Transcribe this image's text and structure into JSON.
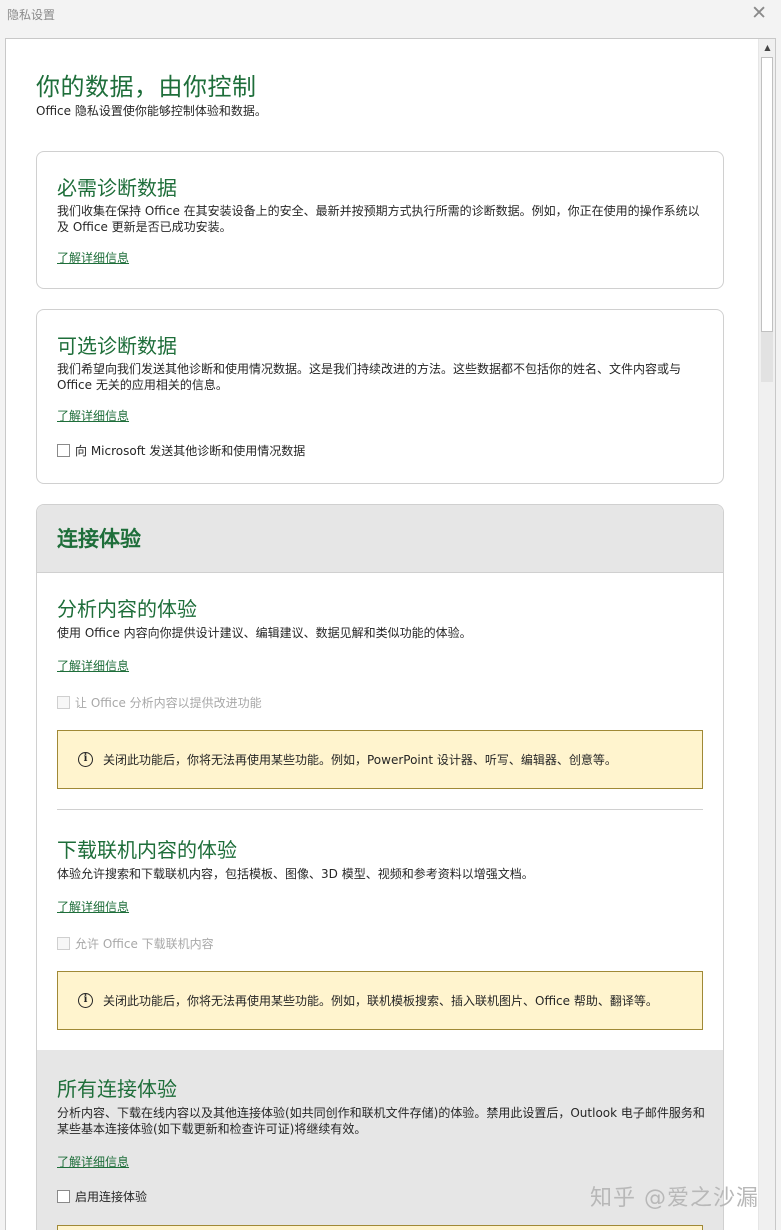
{
  "window": {
    "title": "隐私设置",
    "close_glyph": "✕"
  },
  "header": {
    "title": "你的数据，由你控制",
    "subtitle": "Office 隐私设置使你能够控制体验和数据。"
  },
  "required_diag": {
    "title": "必需诊断数据",
    "desc": "我们收集在保持 Office 在其安装设备上的安全、最新并按预期方式执行所需的诊断数据。例如，你正在使用的操作系统以及 Office 更新是否已成功安装。",
    "learn_more": "了解详细信息"
  },
  "optional_diag": {
    "title": "可选诊断数据",
    "desc": "我们希望向我们发送其他诊断和使用情况数据。这是我们持续改进的方法。这些数据都不包括你的姓名、文件内容或与 Office 无关的应用相关的信息。",
    "learn_more": "了解详细信息",
    "checkbox_label": "向 Microsoft 发送其他诊断和使用情况数据",
    "checked": false
  },
  "connected": {
    "header": "连接体验",
    "analyze": {
      "title": "分析内容的体验",
      "desc": "使用 Office 内容向你提供设计建议、编辑建议、数据见解和类似功能的体验。",
      "learn_more": "了解详细信息",
      "checkbox_label": "让 Office 分析内容以提供改进功能",
      "checked": false,
      "disabled": true,
      "info": "关闭此功能后，你将无法再使用某些功能。例如，PowerPoint 设计器、听写、编辑器、创意等。"
    },
    "download": {
      "title": "下载联机内容的体验",
      "desc": "体验允许搜索和下载联机内容，包括模板、图像、3D 模型、视频和参考资料以增强文档。",
      "learn_more": "了解详细信息",
      "checkbox_label": "允许 Office 下载联机内容",
      "checked": false,
      "disabled": true,
      "info": "关闭此功能后，你将无法再使用某些功能。例如，联机模板搜索、插入联机图片、Office 帮助、翻译等。"
    },
    "all": {
      "title": "所有连接体验",
      "desc": "分析内容、下载在线内容以及其他连接体验(如共同创作和联机文件存储)的体验。禁用此设置后，Outlook 电子邮件服务和某些基本连接体验(如下载更新和检查许可证)将继续有效。",
      "learn_more": "了解详细信息",
      "checkbox_label": "启用连接体验",
      "checked": false
    }
  },
  "icons": {
    "info": "i",
    "scroll_up": "▲"
  },
  "colors": {
    "accent_green": "#1e6e3a",
    "info_bg": "#fff4ce",
    "info_border": "#a08936"
  },
  "watermark": "知乎 @爱之沙漏"
}
